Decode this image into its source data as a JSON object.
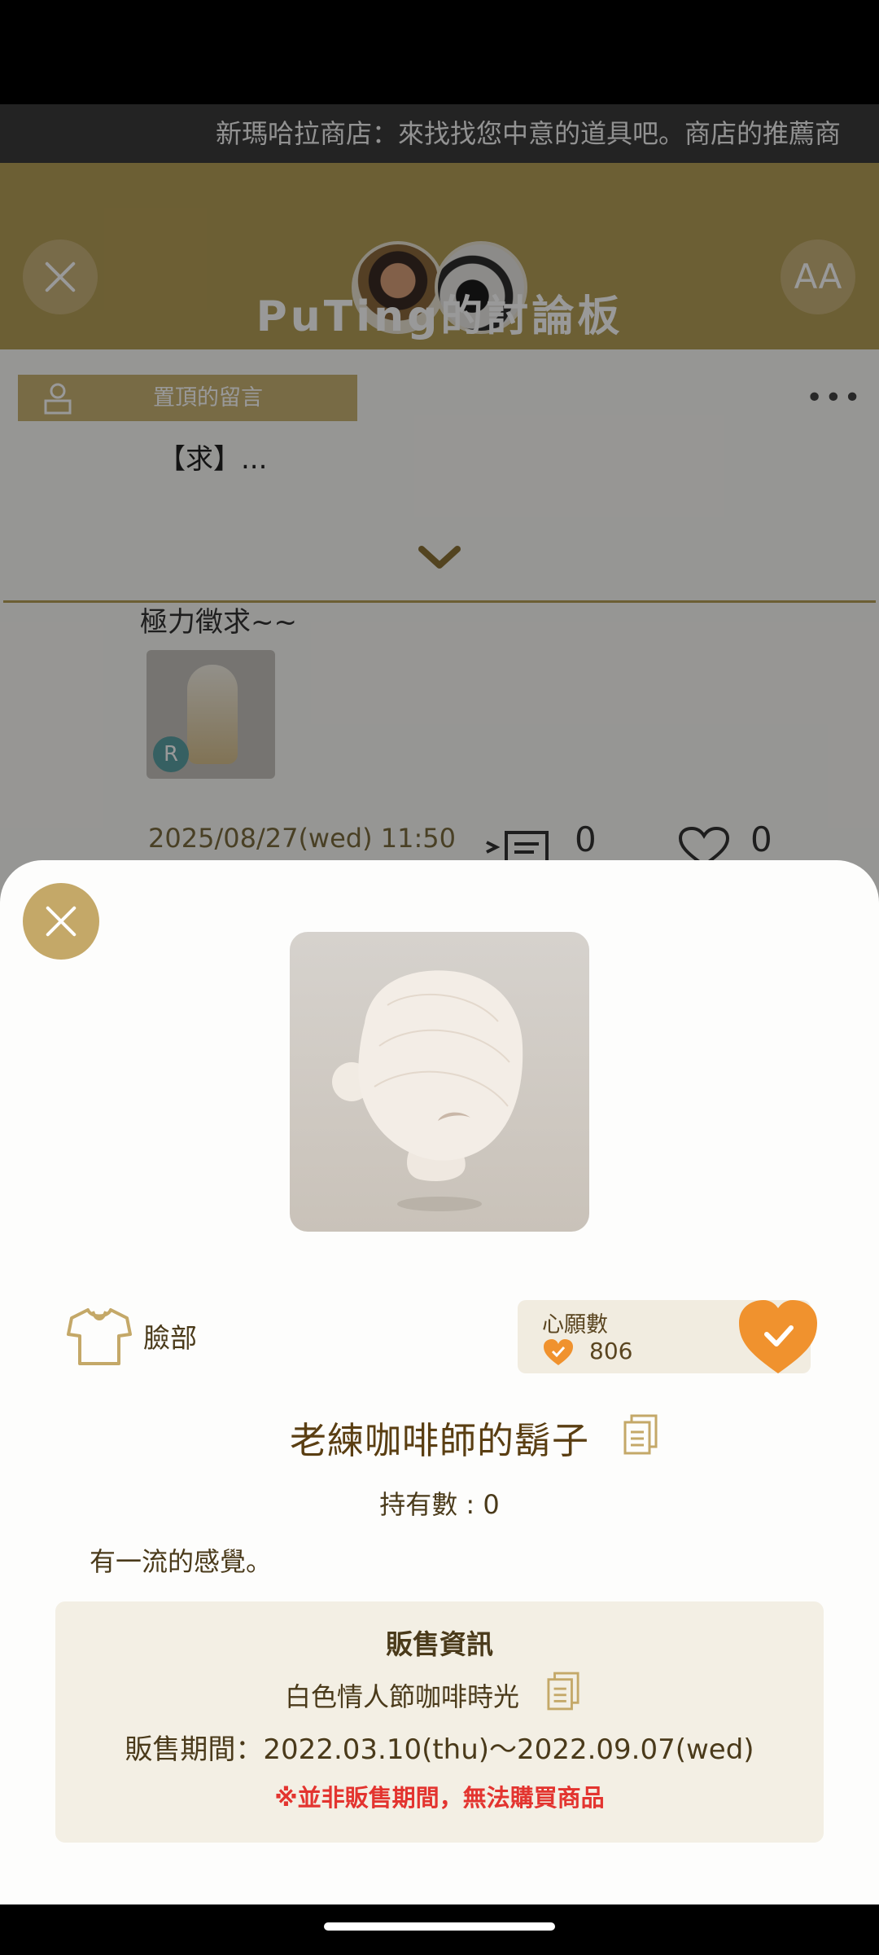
{
  "background": {
    "marquee": "新瑪哈拉商店：來找找您中意的道具吧。商店的推薦商",
    "board_title": "PuTing的討論板",
    "font_button_label": "AA",
    "pinned_label": "置頂的留言",
    "more_label": "•••",
    "pinned_preview": "【求】...",
    "post_text": "極力徵求~~",
    "post_badge": "R",
    "post_date": "2025/08/27(wed) 11:50",
    "reply_count": "0",
    "like_count": "0"
  },
  "item": {
    "category": "臉部",
    "category_icon": "shirt-icon",
    "wish_label": "心願數",
    "wish_count": "806",
    "wish_color": "#f0922e",
    "name": "老練咖啡師的鬍子",
    "owned": "持有數 : 0",
    "description": "有一流的感覺。"
  },
  "sale": {
    "title": "販售資訊",
    "event": "白色情人節咖啡時光",
    "period": "販售期間：2022.03.10(thu)～2022.09.07(wed)",
    "warning": "※並非販售期間，無法購買商品",
    "warning_color": "#e3342f"
  },
  "colors": {
    "accent_gold": "#c4a868",
    "header_gold": "#b59f57",
    "text_brown": "#4a3a1a"
  }
}
